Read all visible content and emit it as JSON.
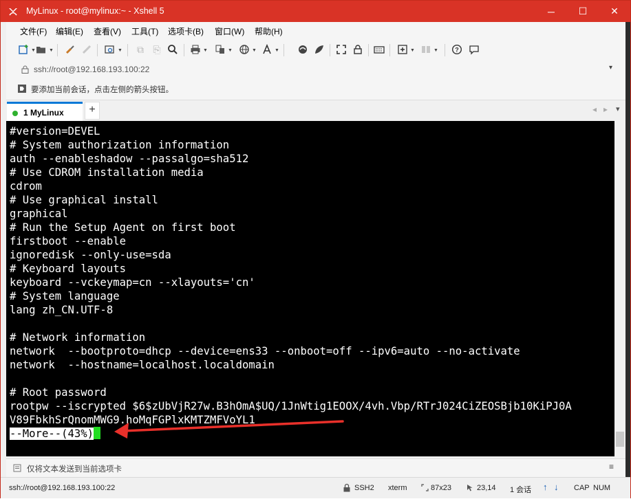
{
  "window": {
    "title": "MyLinux - root@mylinux:~ - Xshell 5",
    "controls": {
      "minimize": "─",
      "maximize": "☐",
      "close": "✕"
    }
  },
  "menu": [
    "文件(F)",
    "编辑(E)",
    "查看(V)",
    "工具(T)",
    "选项卡(B)",
    "窗口(W)",
    "帮助(H)"
  ],
  "address": {
    "url": "ssh://root@192.168.193.100:22",
    "dropdown": "▾"
  },
  "hint": {
    "text": "要添加当前会话，点击左侧的箭头按钮。"
  },
  "tabs": {
    "active": "1 MyLinux",
    "add": "+",
    "nav_left": "◂",
    "nav_right": "▸",
    "menu": "▾"
  },
  "terminal": {
    "lines": [
      "#version=DEVEL",
      "# System authorization information",
      "auth --enableshadow --passalgo=sha512",
      "# Use CDROM installation media",
      "cdrom",
      "# Use graphical install",
      "graphical",
      "# Run the Setup Agent on first boot",
      "firstboot --enable",
      "ignoredisk --only-use=sda",
      "# Keyboard layouts",
      "keyboard --vckeymap=cn --xlayouts='cn'",
      "# System language",
      "lang zh_CN.UTF-8",
      "",
      "# Network information",
      "network  --bootproto=dhcp --device=ens33 --onboot=off --ipv6=auto --no-activate",
      "network  --hostname=localhost.localdomain",
      "",
      "# Root password",
      "rootpw --iscrypted $6$zUbVjR27w.B3hOmA$UQ/1JnWtig1EOOX/4vh.Vbp/RTrJ024CiZEOSBjb10KiPJ0A",
      "V89FbkhSrQnomMWG9.hoMqFGPlxKMTZMFVoYL1"
    ],
    "pager": "--More--(43%)",
    "annotation_arrow_color": "#e8302a",
    "cursor_color": "#22dd22"
  },
  "send_bar": {
    "text": "仅将文本发送到当前选项卡"
  },
  "status": {
    "connection": "ssh://root@192.168.193.100:22",
    "protocol": "SSH2",
    "term": "xterm",
    "size": "87x23",
    "position": "23,14",
    "sessions": "1 会话",
    "cap": "CAP",
    "num": "NUM"
  },
  "colors": {
    "titlebar": "#d93326",
    "tab_accent": "#0078d7",
    "terminal_bg": "#000000",
    "terminal_fg": "#ffffff"
  }
}
